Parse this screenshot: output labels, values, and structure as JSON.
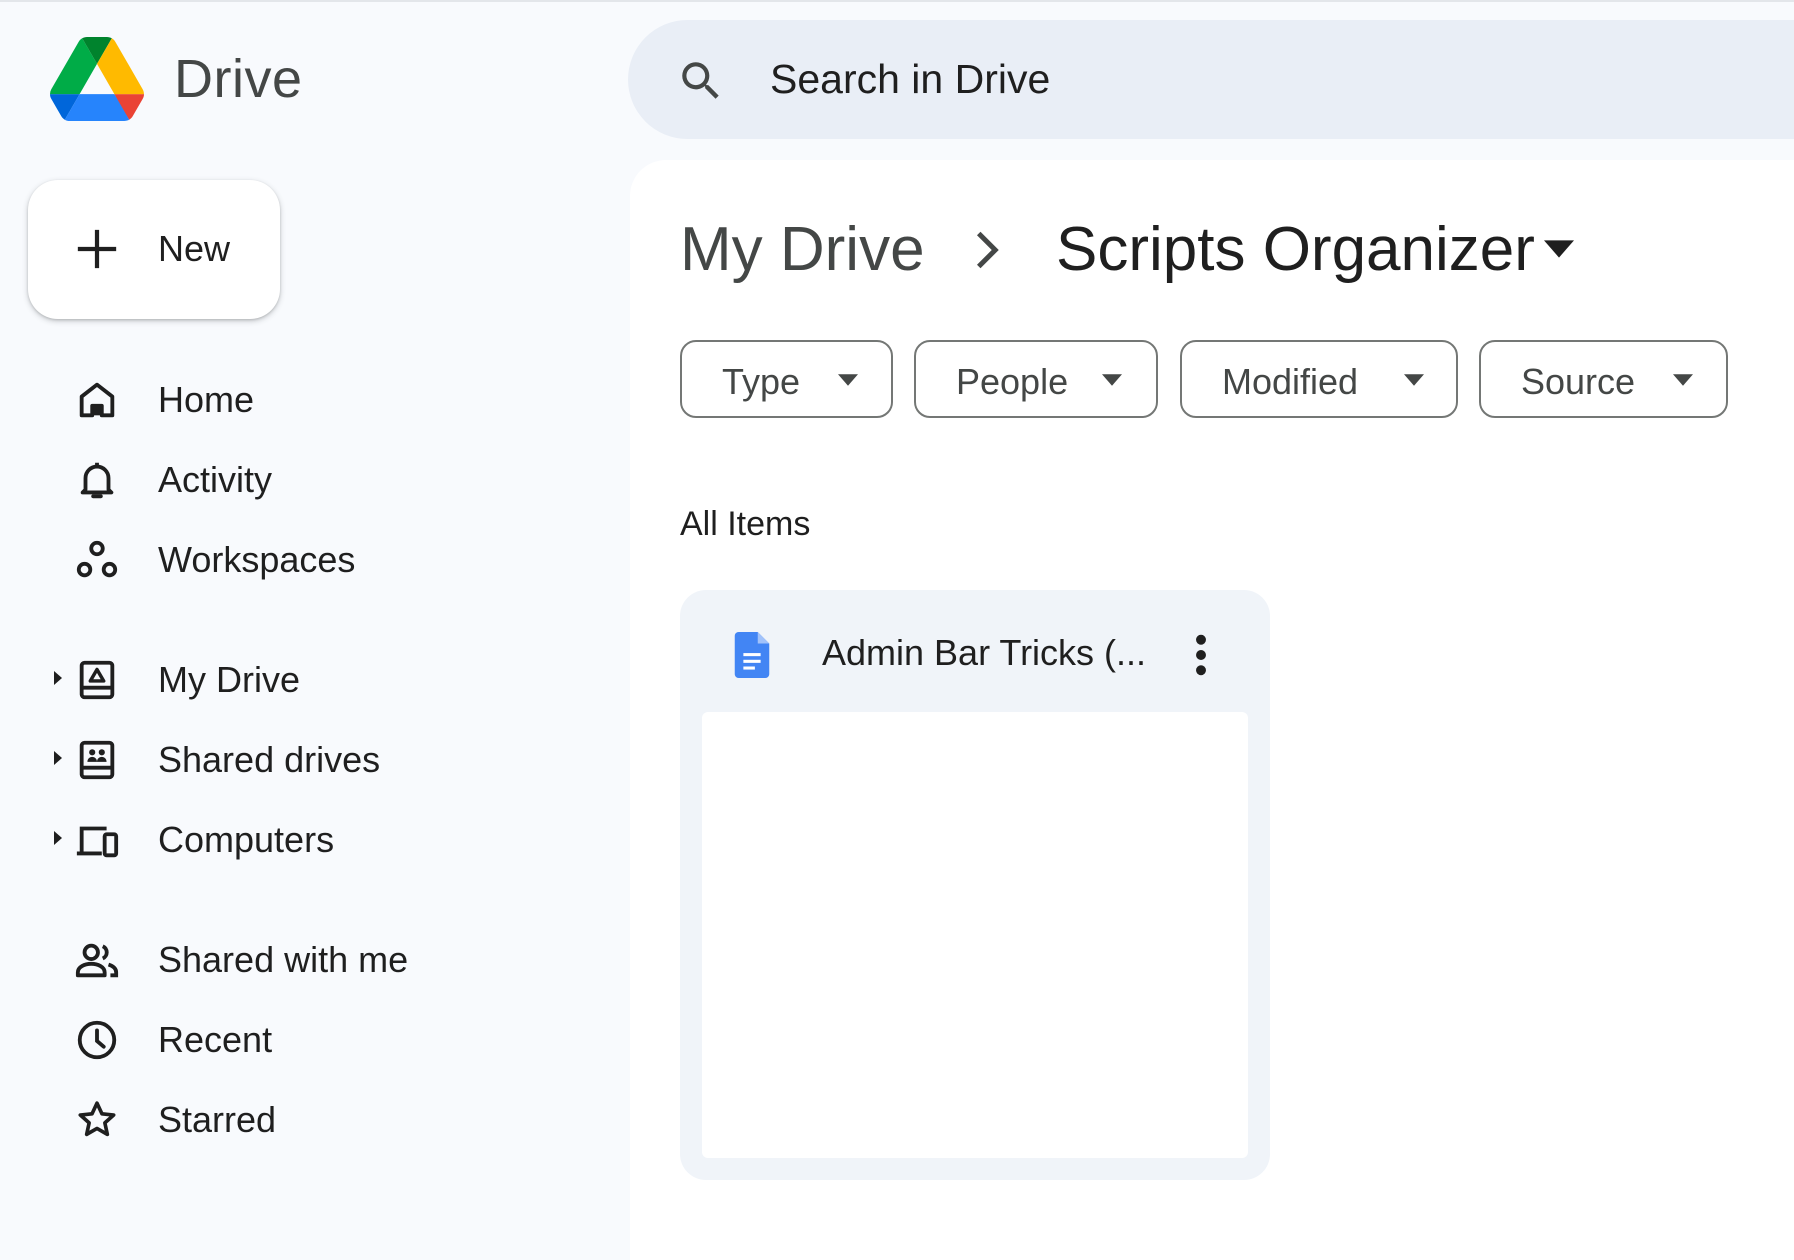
{
  "app": {
    "name": "Drive"
  },
  "search": {
    "placeholder": "Search in Drive"
  },
  "new_button": {
    "label": "New"
  },
  "sidebar": {
    "items": [
      {
        "label": "Home",
        "icon": "home-icon"
      },
      {
        "label": "Activity",
        "icon": "bell-icon"
      },
      {
        "label": "Workspaces",
        "icon": "workspaces-icon"
      },
      {
        "label": "My Drive",
        "icon": "my-drive-icon",
        "expandable": true
      },
      {
        "label": "Shared drives",
        "icon": "shared-drives-icon",
        "expandable": true
      },
      {
        "label": "Computers",
        "icon": "computers-icon",
        "expandable": true
      },
      {
        "label": "Shared with me",
        "icon": "people-icon"
      },
      {
        "label": "Recent",
        "icon": "clock-icon"
      },
      {
        "label": "Starred",
        "icon": "star-icon"
      }
    ]
  },
  "breadcrumb": {
    "root": "My Drive",
    "current": "Scripts Organizer"
  },
  "filters": [
    {
      "label": "Type"
    },
    {
      "label": "People"
    },
    {
      "label": "Modified"
    },
    {
      "label": "Source"
    }
  ],
  "section": {
    "title": "All Items"
  },
  "files": [
    {
      "name": "Admin Bar Tricks (...",
      "icon": "google-docs-icon"
    }
  ],
  "colors": {
    "background": "#f8fafd",
    "search_bg": "#e9eef6",
    "card_bg": "#f0f4f9",
    "docs_blue": "#4285f4"
  }
}
